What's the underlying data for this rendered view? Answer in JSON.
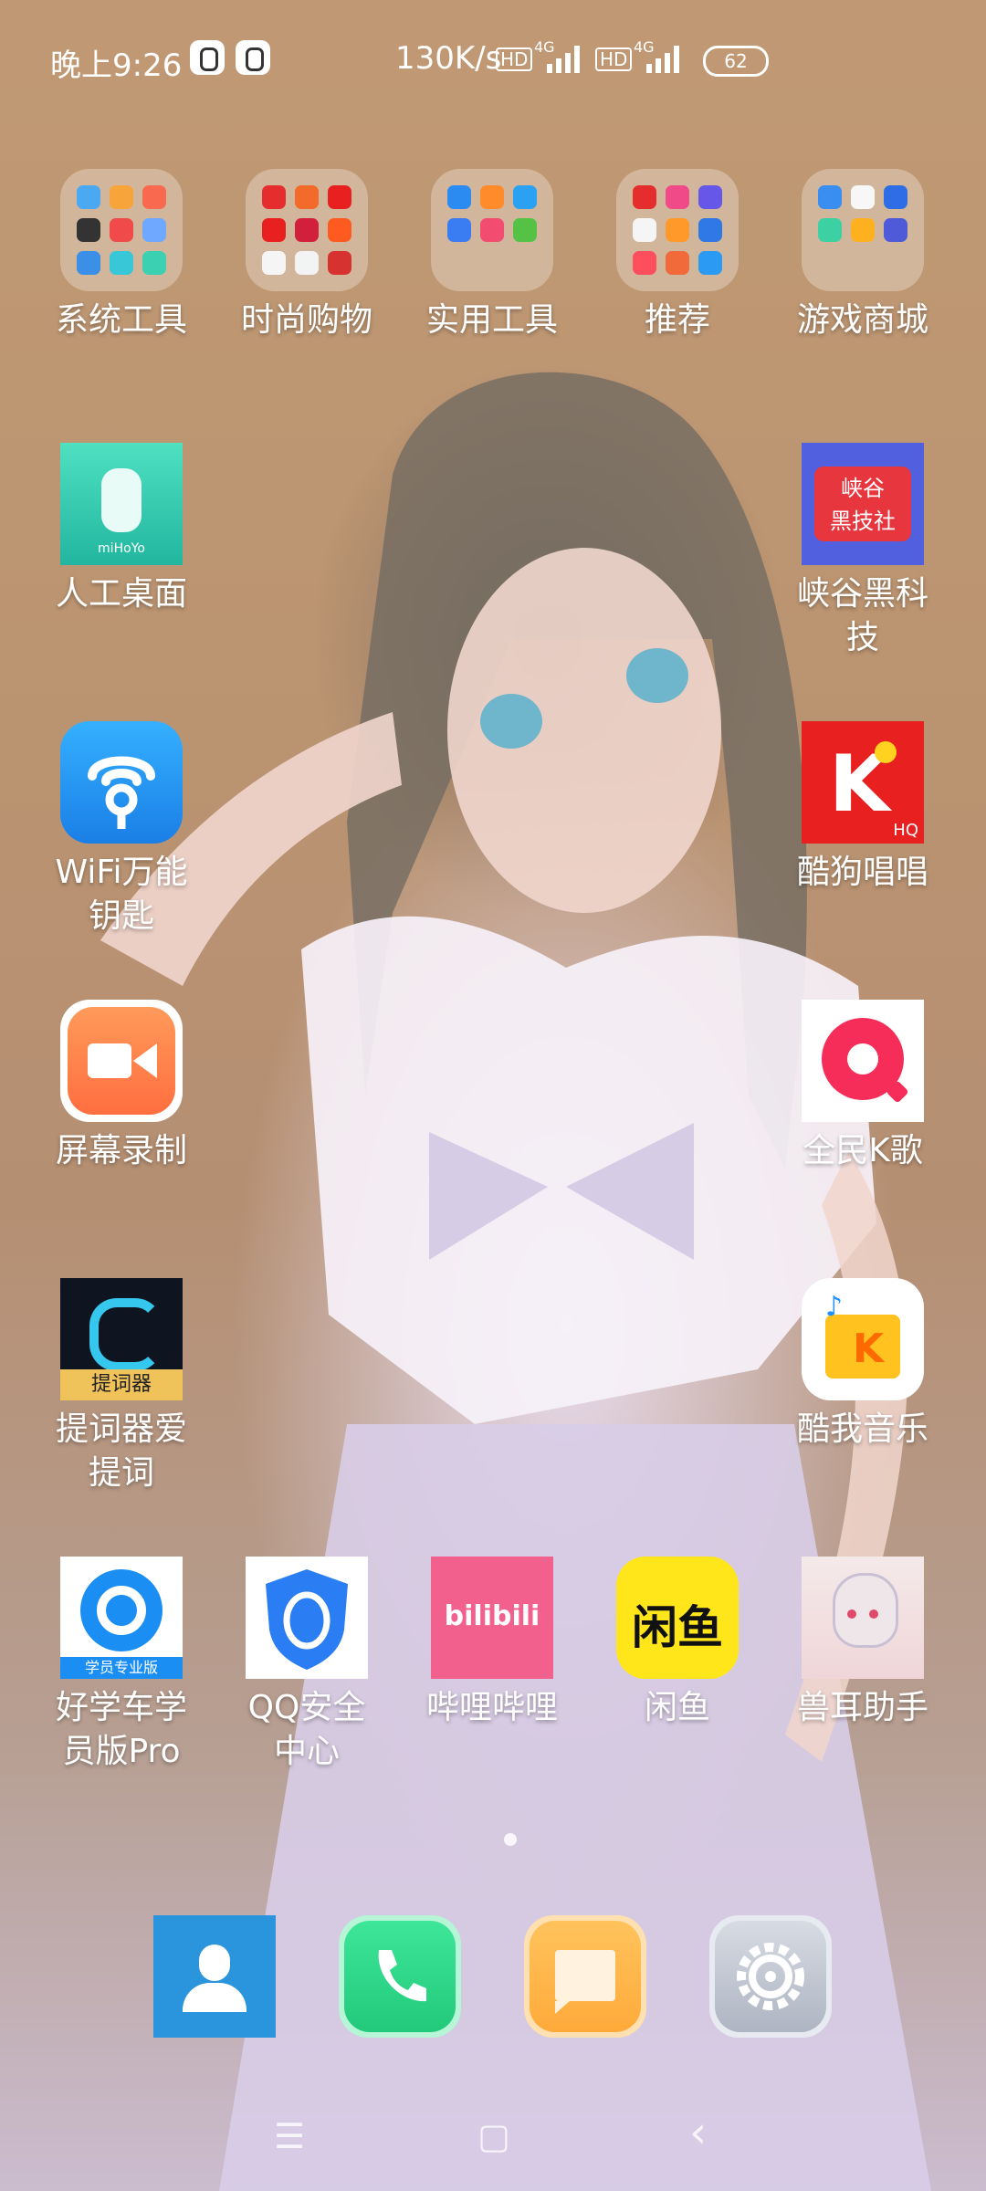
{
  "status_bar": {
    "time": "晚上9:26",
    "net_speed": "130K/s",
    "hd1": "HD",
    "net1": "4G",
    "hd2": "HD",
    "net2": "4G",
    "battery": "62"
  },
  "folders": [
    {
      "label": "系统工具",
      "icon": "folder-system-tools-icon"
    },
    {
      "label": "时尚购物",
      "icon": "folder-shopping-icon"
    },
    {
      "label": "实用工具",
      "icon": "folder-utilities-icon"
    },
    {
      "label": "推荐",
      "icon": "folder-recommended-icon"
    },
    {
      "label": "游戏商城",
      "icon": "folder-game-store-icon"
    }
  ],
  "apps_left": [
    {
      "label": "人工桌面",
      "icon": "mihoyo-icon",
      "color": "#2fc9a8"
    },
    {
      "label": "WiFi万能\n钥匙",
      "icon": "wifi-key-icon",
      "color": "#1a8cf0"
    },
    {
      "label": "屏幕录制",
      "icon": "screen-record-icon",
      "color": "#ff7a4a"
    },
    {
      "label": "提词器爱\n提词",
      "icon": "teleprompter-icon",
      "color": "#11161f"
    }
  ],
  "apps_right": [
    {
      "label": "峡谷黑科\n技",
      "icon": "canyon-tech-icon",
      "color": "#4a56d8",
      "badge_line1": "峡谷",
      "badge_line2": "黑技社"
    },
    {
      "label": "酷狗唱唱",
      "icon": "kugou-sing-icon",
      "color": "#e8201f",
      "badge": "HQ"
    },
    {
      "label": "全民K歌",
      "icon": "national-karaoke-icon",
      "color": "#ffffff"
    },
    {
      "label": "酷我音乐",
      "icon": "kuwo-music-icon",
      "color": "#ffffff"
    }
  ],
  "row_bottom": [
    {
      "label": "好学车学\n员版Pro",
      "icon": "haoxueche-icon",
      "color": "#ffffff",
      "badge": "学员专业版"
    },
    {
      "label": "QQ安全\n中心",
      "icon": "qq-security-icon",
      "color": "#ffffff"
    },
    {
      "label": "哔哩哔哩",
      "icon": "bilibili-icon",
      "color": "#f2608d",
      "logo": "bilibili"
    },
    {
      "label": "闲鱼",
      "icon": "xianyu-icon",
      "color": "#ffe61a",
      "logo": "闲鱼"
    },
    {
      "label": "兽耳助手",
      "icon": "beast-ear-icon",
      "color": "#f7e6e6"
    }
  ],
  "dock": [
    {
      "name": "contacts",
      "icon": "contacts-icon",
      "color": "#2a95dc"
    },
    {
      "name": "phone",
      "icon": "phone-icon",
      "color": "#2fdd8a"
    },
    {
      "name": "messages",
      "icon": "messages-icon",
      "color": "#ffb44c"
    },
    {
      "name": "settings",
      "icon": "settings-icon",
      "color": "#c2c8d4"
    }
  ],
  "navbar": {
    "menu": "☰",
    "home": "▢",
    "back": "‹"
  }
}
